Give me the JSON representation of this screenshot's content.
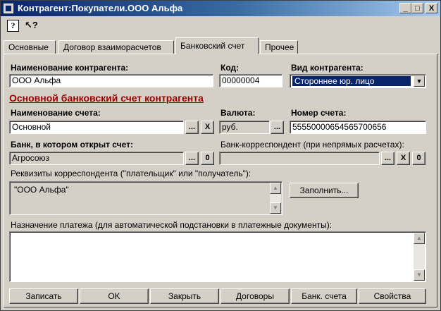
{
  "window": {
    "title": "Контрагент:Покупатели.ООО Альфа"
  },
  "titlebar_buttons": {
    "minimize": "_",
    "maximize": "□",
    "close": "X"
  },
  "toolbar": {
    "help_glyph": "?",
    "whatis_glyph": "↖?"
  },
  "tabs": [
    {
      "label": "Основные",
      "active": false
    },
    {
      "label": "Договор взаиморасчетов",
      "active": false
    },
    {
      "label": "Банковский счет",
      "active": true
    },
    {
      "label": "Прочее",
      "active": false
    }
  ],
  "form": {
    "counterparty_name_label": "Наименование контрагента:",
    "counterparty_name_value": "ООО Альфа",
    "code_label": "Код:",
    "code_value": "00000004",
    "counterparty_type_label": "Вид контрагента:",
    "counterparty_type_value": "Стороннее юр. лицо",
    "section_heading": "Основной банковский счет контрагента",
    "account_name_label": "Наименование счета:",
    "account_name_value": "Основной",
    "currency_label": "Валюта:",
    "currency_value": "руб.",
    "account_number_label": "Номер счета:",
    "account_number_value": "55550000654565700656",
    "bank_label": "Банк, в котором открыт счет:",
    "bank_value": "Агросоюз",
    "corr_bank_label": "Банк-корреспондент (при непрямых расчетах):",
    "corr_bank_value": "",
    "corr_details_label": "Реквизиты корреспондента (\"плательщик\" или \"получатель\"):",
    "corr_details_value": "\"ООО Альфа\"",
    "fill_button": "Заполнить...",
    "payment_purpose_label": "Назначение платежа (для автоматической подстановки в платежные документы):",
    "payment_purpose_value": "",
    "select_glyph": "...",
    "clear_glyph": "X",
    "zero_glyph": "0"
  },
  "bottom_buttons": {
    "save": "Записать",
    "ok": "OK",
    "close": "Закрыть",
    "contracts": "Договоры",
    "bank_accounts": "Банк. счета",
    "properties": "Свойства"
  },
  "colors": {
    "accent_heading": "#a00000",
    "selection": "#0a246a",
    "titlebar": "#0a246a",
    "face": "#d4d0c8"
  },
  "icons": [
    "help-icon",
    "whats-this-icon",
    "chevron-down-icon",
    "arrow-up-icon",
    "arrow-down-icon",
    "window-icon"
  ]
}
